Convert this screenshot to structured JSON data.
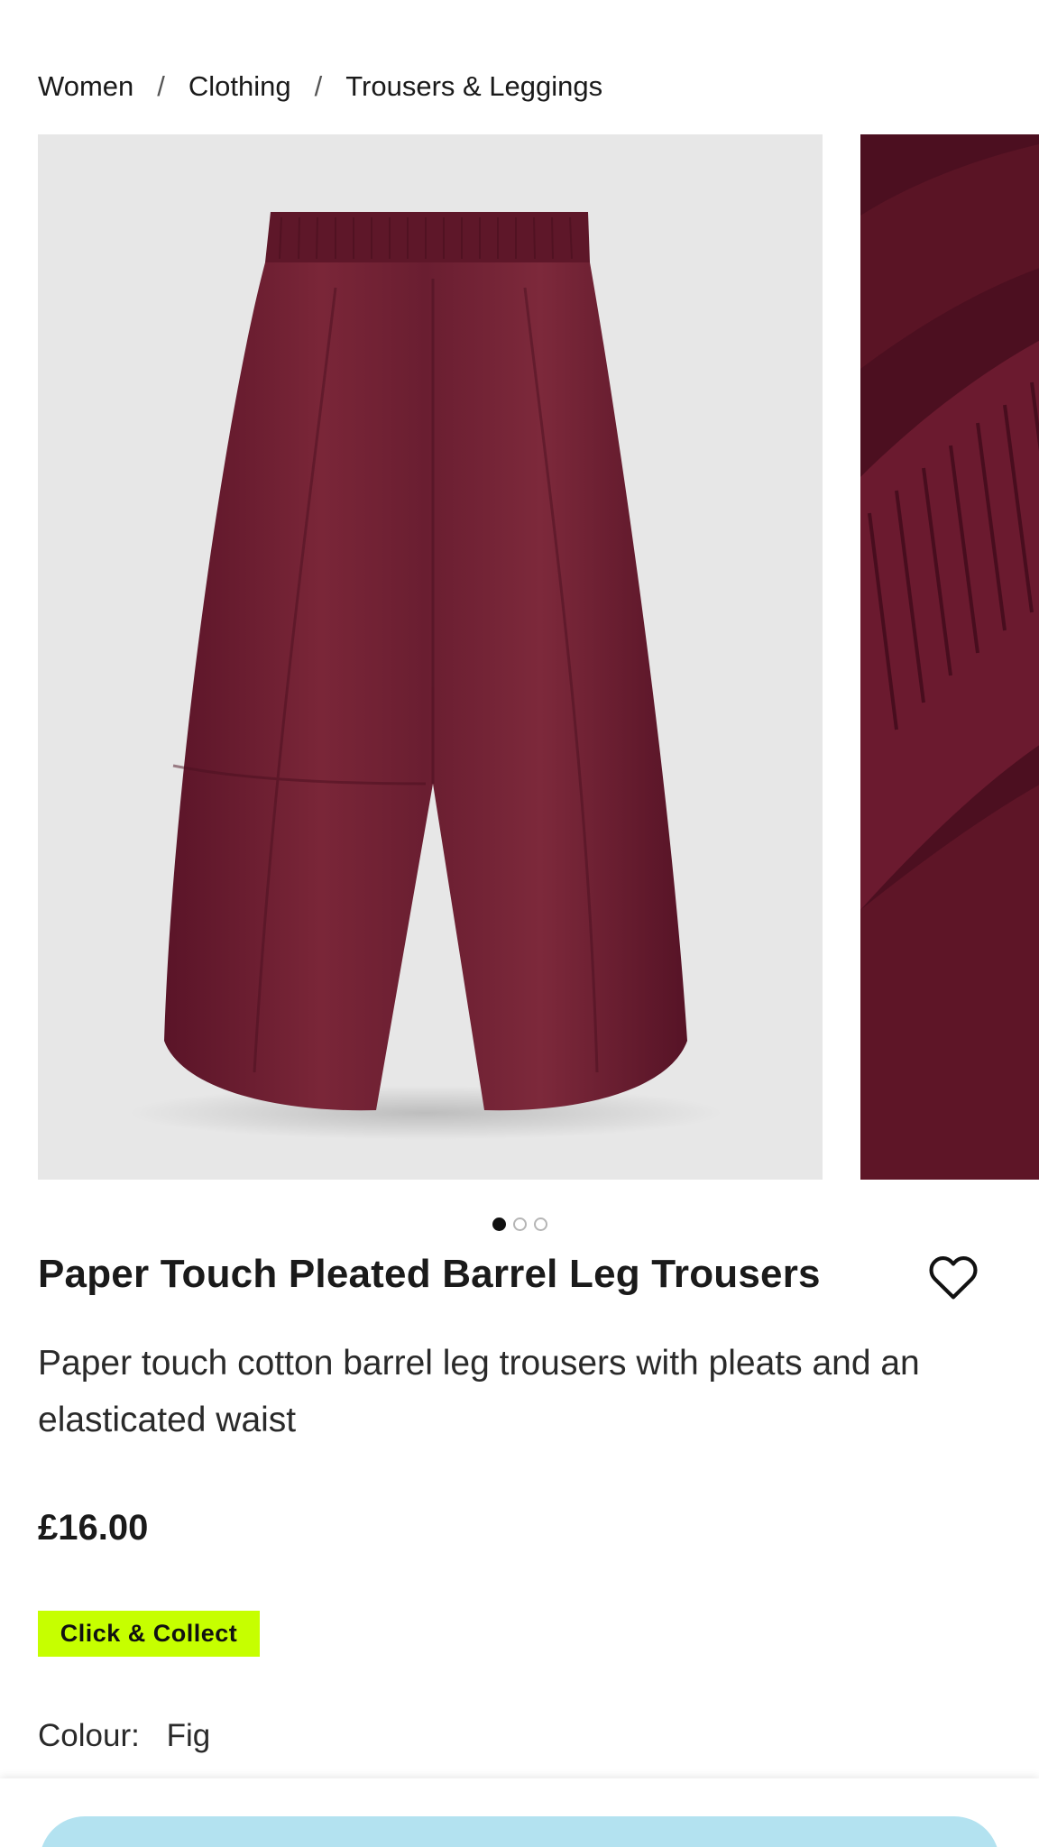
{
  "breadcrumb": {
    "items": [
      "Women",
      "Clothing",
      "Trousers & Leggings"
    ],
    "separator": "/"
  },
  "gallery": {
    "slide_count": 3,
    "active_index": 0,
    "images": [
      "trousers-front-image",
      "waistband-detail-image"
    ]
  },
  "product": {
    "title": "Paper Touch Pleated Barrel Leg Trousers",
    "description": "Paper touch cotton barrel leg trousers with pleats and an elasticated waist",
    "price": "£16.00",
    "badge": "Click & Collect",
    "colour_label": "Colour:",
    "colour_value": "Fig"
  },
  "icons": {
    "wishlist": "heart-outline-icon"
  },
  "colors": {
    "badge_bg": "#c6ff00",
    "cta_bg": "#b3e2f0",
    "garment": "#6e1f33"
  }
}
